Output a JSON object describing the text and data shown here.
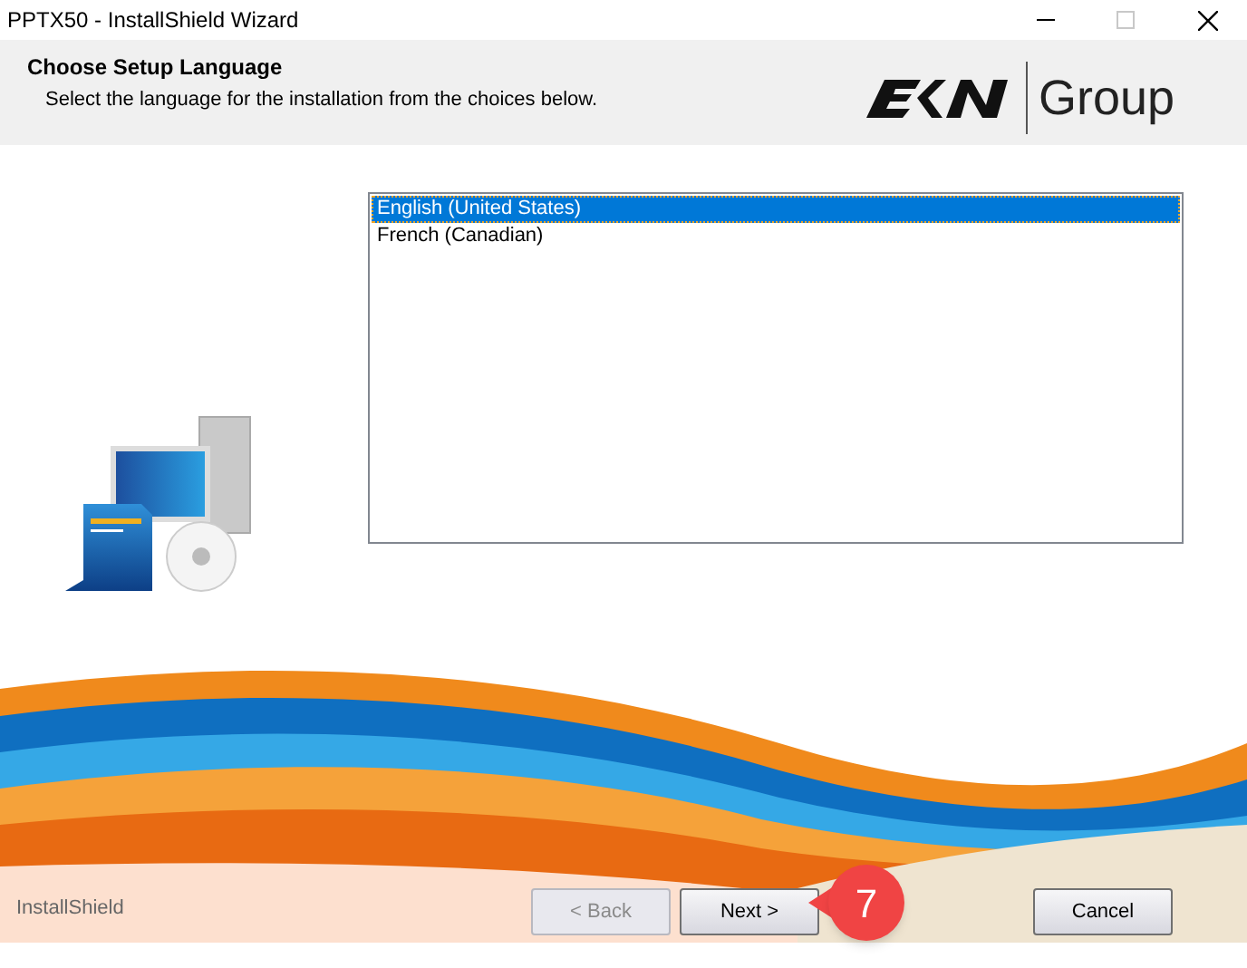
{
  "window": {
    "title": "PPTX50 - InstallShield Wizard"
  },
  "header": {
    "title": "Choose Setup Language",
    "subtitle": "Select the language for the installation from the choices below."
  },
  "logo": {
    "text": "Group"
  },
  "languages": [
    {
      "label": "English (United States)",
      "selected": true
    },
    {
      "label": "French (Canadian)",
      "selected": false
    }
  ],
  "footer": {
    "brand": "InstallShield"
  },
  "buttons": [
    {
      "label": "< Back",
      "disabled": true
    },
    {
      "label": "Next >",
      "disabled": false
    },
    {
      "label": "Cancel",
      "disabled": false
    }
  ],
  "callout": {
    "text": "7"
  }
}
